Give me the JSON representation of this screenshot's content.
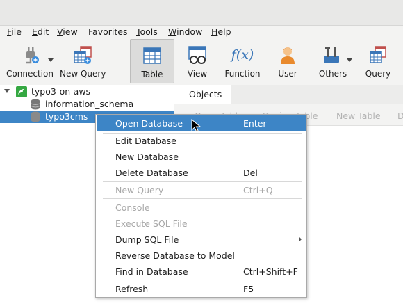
{
  "menubar": [
    "File",
    "Edit",
    "View",
    "Favorites",
    "Tools",
    "Window",
    "Help"
  ],
  "toolbar": {
    "connection": "Connection",
    "new_query": "New Query",
    "table": "Table",
    "view": "View",
    "function": "Function",
    "function_glyph": "f(x)",
    "user": "User",
    "others": "Others",
    "query": "Query"
  },
  "tree": {
    "connection": "typo3-on-aws",
    "db1": "information_schema",
    "db2": "typo3cms"
  },
  "objects": {
    "tab": "Objects",
    "buttons": [
      "Open Table",
      "Design Table",
      "New Table",
      "De"
    ]
  },
  "context_menu": {
    "items": [
      {
        "label": "Open Database",
        "shortcut": "Enter",
        "state": "highlighted"
      },
      {
        "label": "Edit Database",
        "shortcut": "",
        "state": "normal"
      },
      {
        "label": "New Database",
        "shortcut": "",
        "state": "normal"
      },
      {
        "label": "Delete Database",
        "shortcut": "Del",
        "state": "normal"
      },
      {
        "label": "New Query",
        "shortcut": "Ctrl+Q",
        "state": "disabled"
      },
      {
        "label": "Console",
        "shortcut": "",
        "state": "disabled"
      },
      {
        "label": "Execute SQL File",
        "shortcut": "",
        "state": "disabled"
      },
      {
        "label": "Dump SQL File",
        "shortcut": "",
        "state": "submenu"
      },
      {
        "label": "Reverse Database to Model",
        "shortcut": "",
        "state": "normal"
      },
      {
        "label": "Find in Database",
        "shortcut": "Ctrl+Shift+F",
        "state": "normal"
      },
      {
        "label": "Refresh",
        "shortcut": "F5",
        "state": "normal"
      }
    ]
  },
  "colors": {
    "accent": "#3d85c6",
    "toolbar_bg": "#f3f3f2"
  }
}
